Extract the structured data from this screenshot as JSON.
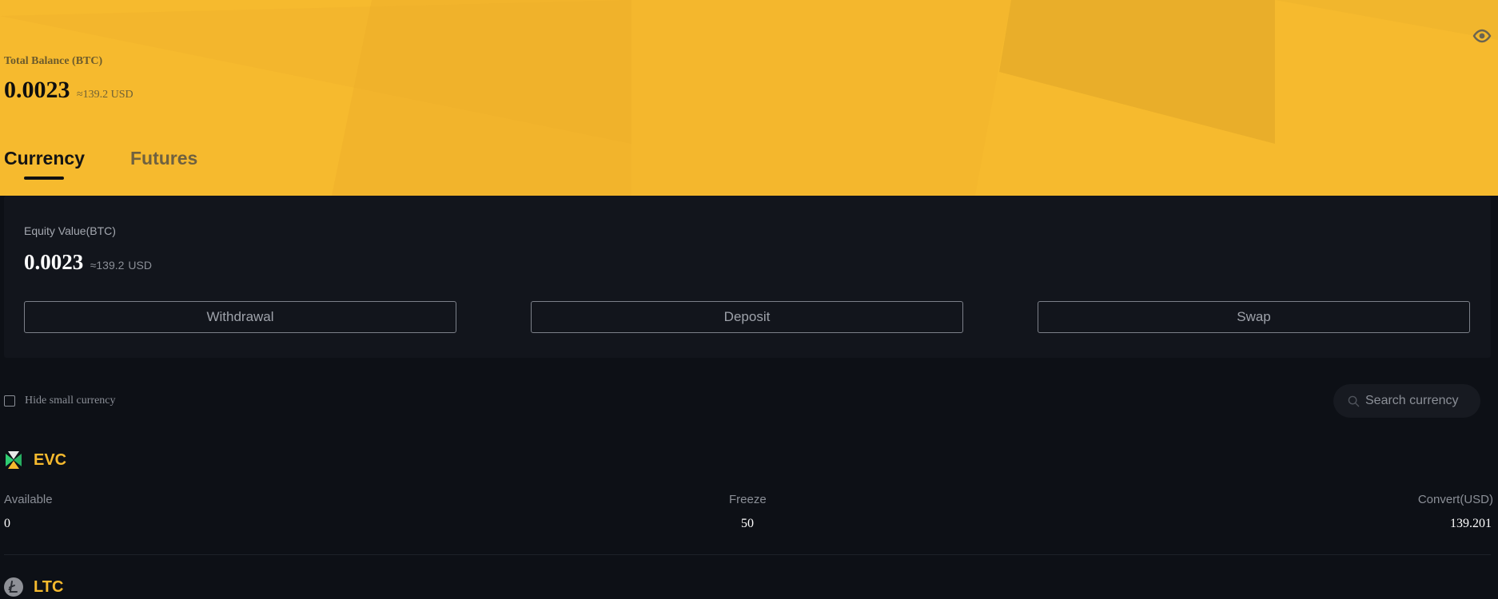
{
  "header": {
    "total_label": "Total Balance (BTC)",
    "total_value": "0.0023",
    "total_usd": "≈139.2 USD",
    "accent_color": "#f6ba2e",
    "visibility_icon": "eye-icon"
  },
  "tabs": [
    {
      "label": "Currency",
      "active": true
    },
    {
      "label": "Futures",
      "active": false
    }
  ],
  "equity": {
    "label": "Equity Value(BTC)",
    "value": "0.0023",
    "usd_approx": "≈139.2",
    "usd_unit": "USD",
    "buttons": {
      "withdrawal": "Withdrawal",
      "deposit": "Deposit",
      "swap": "Swap"
    }
  },
  "filter": {
    "hide_small_label": "Hide small currency",
    "hide_small_checked": false,
    "search_placeholder": "Search currency",
    "search_icon": "search-icon"
  },
  "currencies": [
    {
      "symbol": "EVC",
      "icon": "evc-coin-icon",
      "available_label": "Available",
      "available": "0",
      "freeze_label": "Freeze",
      "freeze": "50",
      "convert_label": "Convert(USD)",
      "convert": "139.201"
    },
    {
      "symbol": "LTC",
      "icon": "ltc-coin-icon"
    }
  ]
}
